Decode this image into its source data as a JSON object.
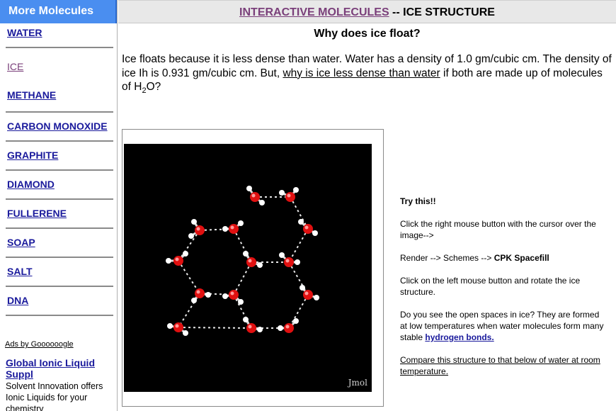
{
  "sidebar": {
    "header": "More Molecules",
    "items": [
      {
        "label": "WATER"
      },
      {
        "label": "ICE"
      },
      {
        "label": "METHANE"
      },
      {
        "label": "CARBON MONOXIDE"
      },
      {
        "label": "GRAPHITE"
      },
      {
        "label": "DIAMOND"
      },
      {
        "label": "FULLERENE"
      },
      {
        "label": "SOAP"
      },
      {
        "label": "SALT"
      },
      {
        "label": "DNA"
      }
    ],
    "ads_label": "Ads by Goooooogle",
    "ad": {
      "title": "Global Ionic Liquid Suppl",
      "text": "Solvent Innovation offers Ionic Liquids for your chemistry"
    }
  },
  "header": {
    "title_link": "INTERACTIVE MOLECULES",
    "title_rest": " -- ICE STRUCTURE"
  },
  "main": {
    "subtitle": "Why does ice float?",
    "intro_part1": "Ice floats because it is less dense than water. Water has a density of 1.0 gm/cubic cm. The density of ice Ih is 0.931 gm/cubic cm. But, ",
    "intro_link": "why is ice less dense than water",
    "intro_part2": " if both are made up of molecules of H",
    "intro_sub": "2",
    "intro_part3": "O?",
    "viewer_label": "Jmol",
    "tips": {
      "heading": "Try this!!",
      "step1": "Click the right mouse button with the cursor over the image-->",
      "step2_prefix": "Render --> Schemes --> ",
      "step2_bold": "CPK Spacefill",
      "step3": "Click on the left mouse button and rotate the ice structure.",
      "step4_prefix": "Do you see the open spaces in ice? They are formed at low temperatures when water molecules form many stable ",
      "step4_link": "hydrogen bonds.",
      "compare_link": "Compare this structure to that below of water at room temperature."
    }
  },
  "colors": {
    "sidebar_header_bg": "#4a8ef0",
    "link": "#1a1a9c",
    "visited_link": "#7a3f7a",
    "oxygen": "#e01010",
    "hydrogen": "#ffffff",
    "viewer_bg": "#000000"
  }
}
